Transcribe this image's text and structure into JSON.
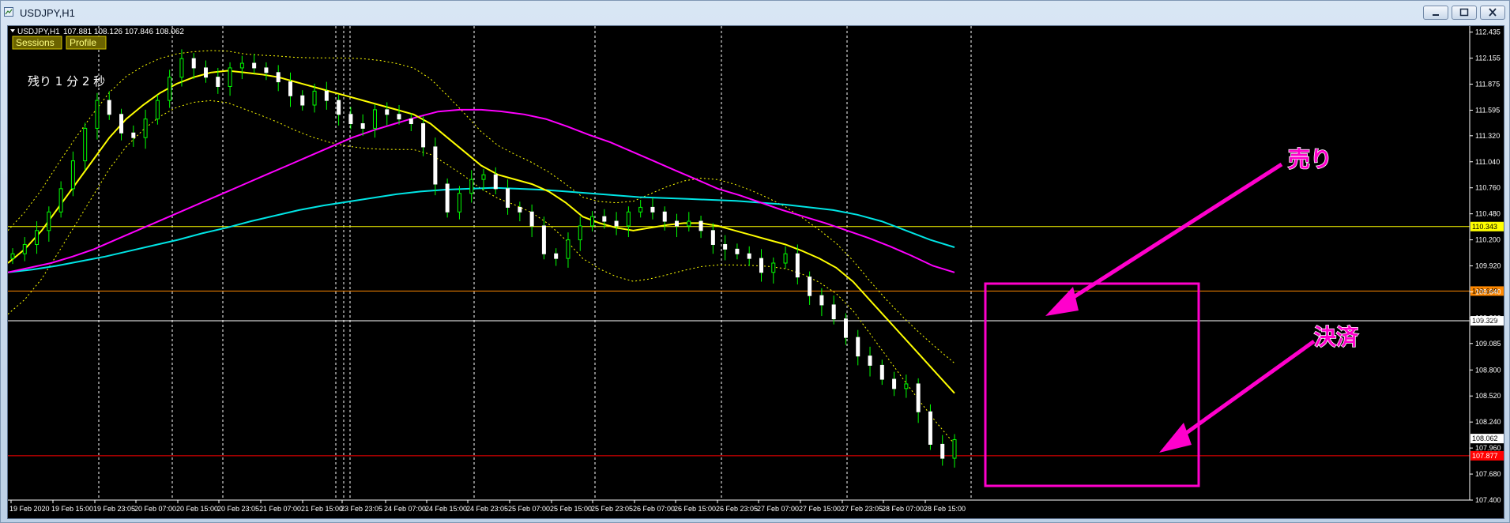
{
  "window": {
    "title": "USDJPY,H1",
    "minimize_icon": "minimize-icon",
    "maximize_icon": "maximize-icon",
    "close_icon": "close-icon"
  },
  "chart_header": {
    "symbol_tf": "USDJPY,H1",
    "ohlc": "107.881 108.126 107.846 108.062",
    "dropdown_icon": "triangle-down-icon"
  },
  "toolbar": {
    "sessions_label": "Sessions",
    "profile_label": "Profile"
  },
  "countdown": "残り 1 分 2 秒",
  "annotations": {
    "sell_label": "売り",
    "settle_label": "決済"
  },
  "colors": {
    "background": "#000000",
    "bull_candle": "#ffffff",
    "bear_candle": "#ffffff",
    "wick": "#00ff00",
    "ma_fast": "#ffff00",
    "ma_mid": "#ff00ff",
    "ma_slow": "#00e5e5",
    "bands": "#ffff00",
    "annotation": "#ff00cc",
    "hline_yellow": "#ffff00",
    "hline_orange": "#ff8800",
    "hline_white": "#ffffff",
    "hline_red": "#ff0000"
  },
  "chart_data": {
    "type": "line",
    "symbol": "USDJPY",
    "timeframe": "H1",
    "ylim": [
      107.4,
      112.5
    ],
    "yticks": [
      "112.435",
      "112.155",
      "111.875",
      "111.595",
      "111.320",
      "111.040",
      "110.760",
      "110.480",
      "110.200",
      "109.920",
      "109.640",
      "109.360",
      "109.085",
      "108.800",
      "108.520",
      "108.240",
      "107.960",
      "107.680",
      "107.400"
    ],
    "xticks": [
      "19 Feb 2020",
      "19 Feb 15:00",
      "19 Feb 23:05",
      "20 Feb 07:00",
      "20 Feb 15:00",
      "20 Feb 23:05",
      "21 Feb 07:00",
      "21 Feb 15:00",
      "23 Feb 23:05",
      "24 Feb 07:00",
      "24 Feb 15:00",
      "24 Feb 23:05",
      "25 Feb 07:00",
      "25 Feb 15:00",
      "25 Feb 23:05",
      "26 Feb 07:00",
      "26 Feb 15:00",
      "26 Feb 23:05",
      "27 Feb 07:00",
      "27 Feb 15:00",
      "27 Feb 23:05",
      "28 Feb 07:00",
      "28 Feb 15:00"
    ],
    "horizontal_levels": [
      {
        "value": 110.343,
        "label": "110.343",
        "color": "#ffff00"
      },
      {
        "value": 109.649,
        "label": "109.649",
        "color": "#ff8800"
      },
      {
        "value": 109.329,
        "label": "109.329",
        "color": "#ffffff"
      },
      {
        "value": 107.877,
        "label": "107.877",
        "color": "#ff0000"
      }
    ],
    "current_price_label": "108.062",
    "close": [
      110.05,
      110.15,
      110.3,
      110.5,
      110.75,
      111.05,
      111.4,
      111.7,
      111.55,
      111.35,
      111.3,
      111.5,
      111.7,
      111.95,
      112.15,
      112.05,
      111.95,
      111.85,
      112.05,
      112.1,
      112.05,
      112.0,
      111.9,
      111.75,
      111.65,
      111.8,
      111.7,
      111.55,
      111.45,
      111.4,
      111.6,
      111.55,
      111.5,
      111.45,
      111.2,
      110.8,
      110.5,
      110.7,
      110.85,
      110.9,
      110.75,
      110.55,
      110.5,
      110.35,
      110.05,
      110.0,
      110.2,
      110.35,
      110.45,
      110.4,
      110.35,
      110.5,
      110.55,
      110.5,
      110.4,
      110.35,
      110.4,
      110.3,
      110.15,
      110.1,
      110.05,
      110.0,
      109.85,
      109.95,
      110.05,
      109.8,
      109.6,
      109.5,
      109.35,
      109.15,
      108.95,
      108.85,
      108.7,
      108.6,
      108.65,
      108.35,
      108.0,
      107.85,
      108.05
    ],
    "ma_fast": [
      109.95,
      110.1,
      110.3,
      110.55,
      110.8,
      111.05,
      111.3,
      111.5,
      111.65,
      111.78,
      111.88,
      111.95,
      112.0,
      112.02,
      112.0,
      111.98,
      111.95,
      111.9,
      111.85,
      111.8,
      111.75,
      111.7,
      111.65,
      111.6,
      111.55,
      111.45,
      111.3,
      111.15,
      111.0,
      110.9,
      110.85,
      110.8,
      110.72,
      110.6,
      110.45,
      110.38,
      110.33,
      110.3,
      110.33,
      110.36,
      110.38,
      110.38,
      110.35,
      110.3,
      110.25,
      110.2,
      110.15,
      110.08,
      110.0,
      109.9,
      109.75,
      109.55,
      109.35,
      109.15,
      108.95,
      108.75,
      108.55
    ],
    "ma_mid": [
      109.85,
      109.9,
      109.95,
      110.02,
      110.1,
      110.2,
      110.3,
      110.4,
      110.5,
      110.6,
      110.7,
      110.8,
      110.9,
      111.0,
      111.1,
      111.2,
      111.3,
      111.38,
      111.45,
      111.52,
      111.58,
      111.6,
      111.6,
      111.58,
      111.55,
      111.5,
      111.42,
      111.33,
      111.25,
      111.15,
      111.05,
      110.95,
      110.85,
      110.75,
      110.68,
      110.6,
      110.52,
      110.45,
      110.38,
      110.3,
      110.22,
      110.13,
      110.03,
      109.92,
      109.85
    ],
    "ma_slow": [
      109.85,
      109.88,
      109.92,
      109.97,
      110.02,
      110.08,
      110.14,
      110.2,
      110.27,
      110.33,
      110.4,
      110.46,
      110.52,
      110.57,
      110.61,
      110.65,
      110.69,
      110.72,
      110.74,
      110.75,
      110.76,
      110.75,
      110.74,
      110.72,
      110.7,
      110.68,
      110.66,
      110.65,
      110.64,
      110.63,
      110.62,
      110.6,
      110.58,
      110.55,
      110.52,
      110.47,
      110.4,
      110.3,
      110.2,
      110.12
    ]
  }
}
